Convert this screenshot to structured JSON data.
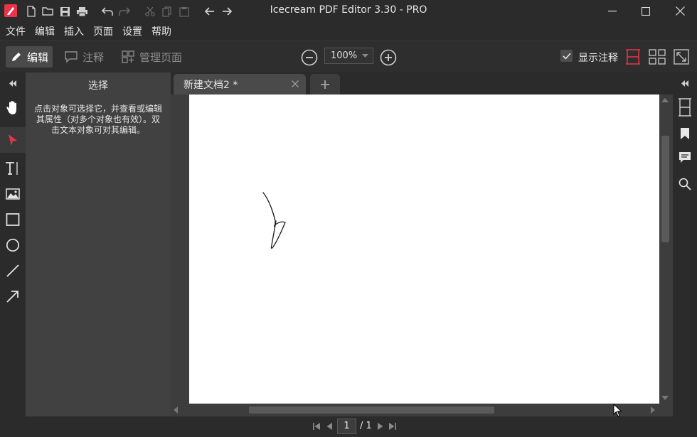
{
  "app": {
    "title": "Icecream PDF Editor 3.30 - PRO"
  },
  "menu": [
    "文件",
    "编辑",
    "插入",
    "页面",
    "设置",
    "帮助"
  ],
  "toolbar": {
    "edit_label": "编辑",
    "annotate_label": "注释",
    "manage_pages_label": "管理页面",
    "zoom_value": "100%",
    "show_annotations_label": "显示注释",
    "show_annotations_checked": true
  },
  "panel": {
    "title": "选择",
    "description": "点击对象可选择它，并查看或编辑其属性（对多个对象也有效）。双击文本对象可对其编辑。"
  },
  "tabs": [
    {
      "label": "新建文档2 *",
      "active": true
    }
  ],
  "pagination": {
    "current": "1",
    "total": "/ 1"
  },
  "colors": {
    "accent": "#e8354b",
    "panel": "#414141",
    "background": "#2b2b2b"
  }
}
